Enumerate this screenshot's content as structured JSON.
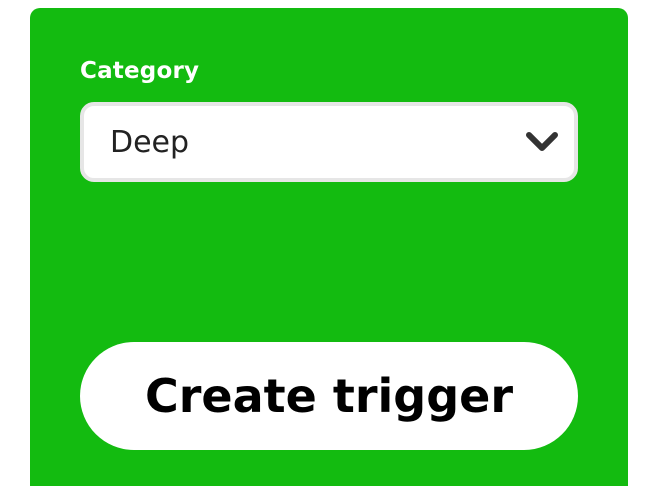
{
  "form": {
    "category_label": "Category",
    "category_select": {
      "selected_value": "Deep",
      "icon": "chevron-down-icon"
    },
    "submit_label": "Create trigger"
  },
  "colors": {
    "panel_background": "#13bb10",
    "select_background": "#ffffff",
    "select_border": "#e6e6e6",
    "button_background": "#ffffff",
    "button_text": "#000000",
    "label_text": "#ffffff"
  }
}
